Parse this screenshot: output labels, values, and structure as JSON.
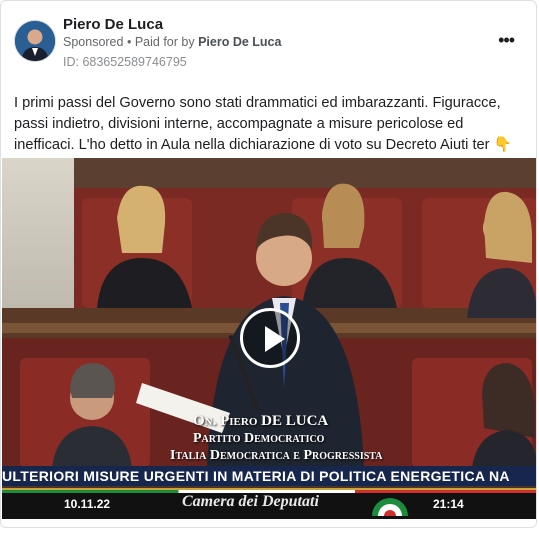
{
  "post": {
    "author": "Piero De Luca",
    "sponsored": "Sponsored",
    "separator": "•",
    "paid_prefix": "Paid for by",
    "paid_by": "Piero De Luca",
    "ad_id": "ID: 683652589746795",
    "more_icon": "more-horizontal-icon",
    "more_glyph": "•••",
    "text": "I primi passi del Governo sono stati drammatici ed imbarazzanti. Figuracce, passi indietro, divisioni interne, accompagnate a misure pericolose ed inefficaci. L'ho detto in Aula nella dichiarazione di voto su Decreto Aiuti ter 👇"
  },
  "video": {
    "caption_name": "On. Piero DE LUCA",
    "caption_party_1": "Partito Democratico",
    "caption_party_2": "Italia Democratica e Progressista",
    "ticker": "ULTERIORI MISURE URGENTI IN MATERIA DI POLITICA ENERGETICA NA",
    "date": "10.11.22",
    "channel": "Camera dei Deputati",
    "time": "21:14",
    "play_icon": "play-icon"
  },
  "colors": {
    "ticker_bg": "#17264c",
    "play_border": "#ffffff"
  }
}
